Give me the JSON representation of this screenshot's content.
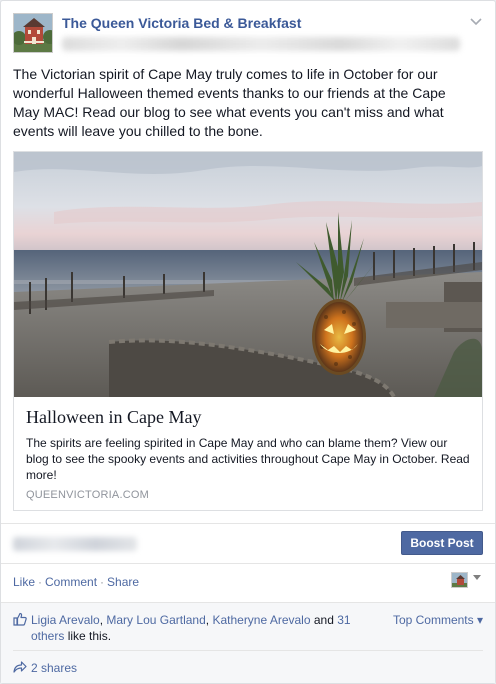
{
  "post": {
    "page_name": "The Queen Victoria Bed & Breakfast",
    "message": "The Victorian spirit of Cape May truly comes to life in October for our wonderful Halloween themed events thanks to our friends at the Cape May MAC! Read our blog to see what events you can't miss and what events will leave you chilled to the bone.",
    "avatar_icon": "victorian-house-icon"
  },
  "link": {
    "title": "Halloween in Cape May",
    "description": "The spirits are feeling spirited in Cape May and who can blame them? View our blog to see the spooky events and activities throughout Cape May in October. Read more!",
    "domain": "QUEENVICTORIA.COM",
    "image_subject": "jack-o-lantern-pineapple-on-beach"
  },
  "boost": {
    "label": "Boost Post",
    "color": "#4e69a2"
  },
  "actions": {
    "like": "Like",
    "comment": "Comment",
    "share": "Share",
    "separator": "·"
  },
  "likes": {
    "names": [
      "Ligia Arevalo",
      "Mary Lou Gartland",
      "Katheryne Arevalo"
    ],
    "separator": ", ",
    "and": " and ",
    "others": "31 others",
    "suffix": " like this."
  },
  "top_comments": "Top Comments ▾",
  "shares": "2 shares",
  "colors": {
    "link_blue": "#3b5998",
    "action_blue": "#4e69a2",
    "ufi_bg": "#f6f7f9"
  }
}
